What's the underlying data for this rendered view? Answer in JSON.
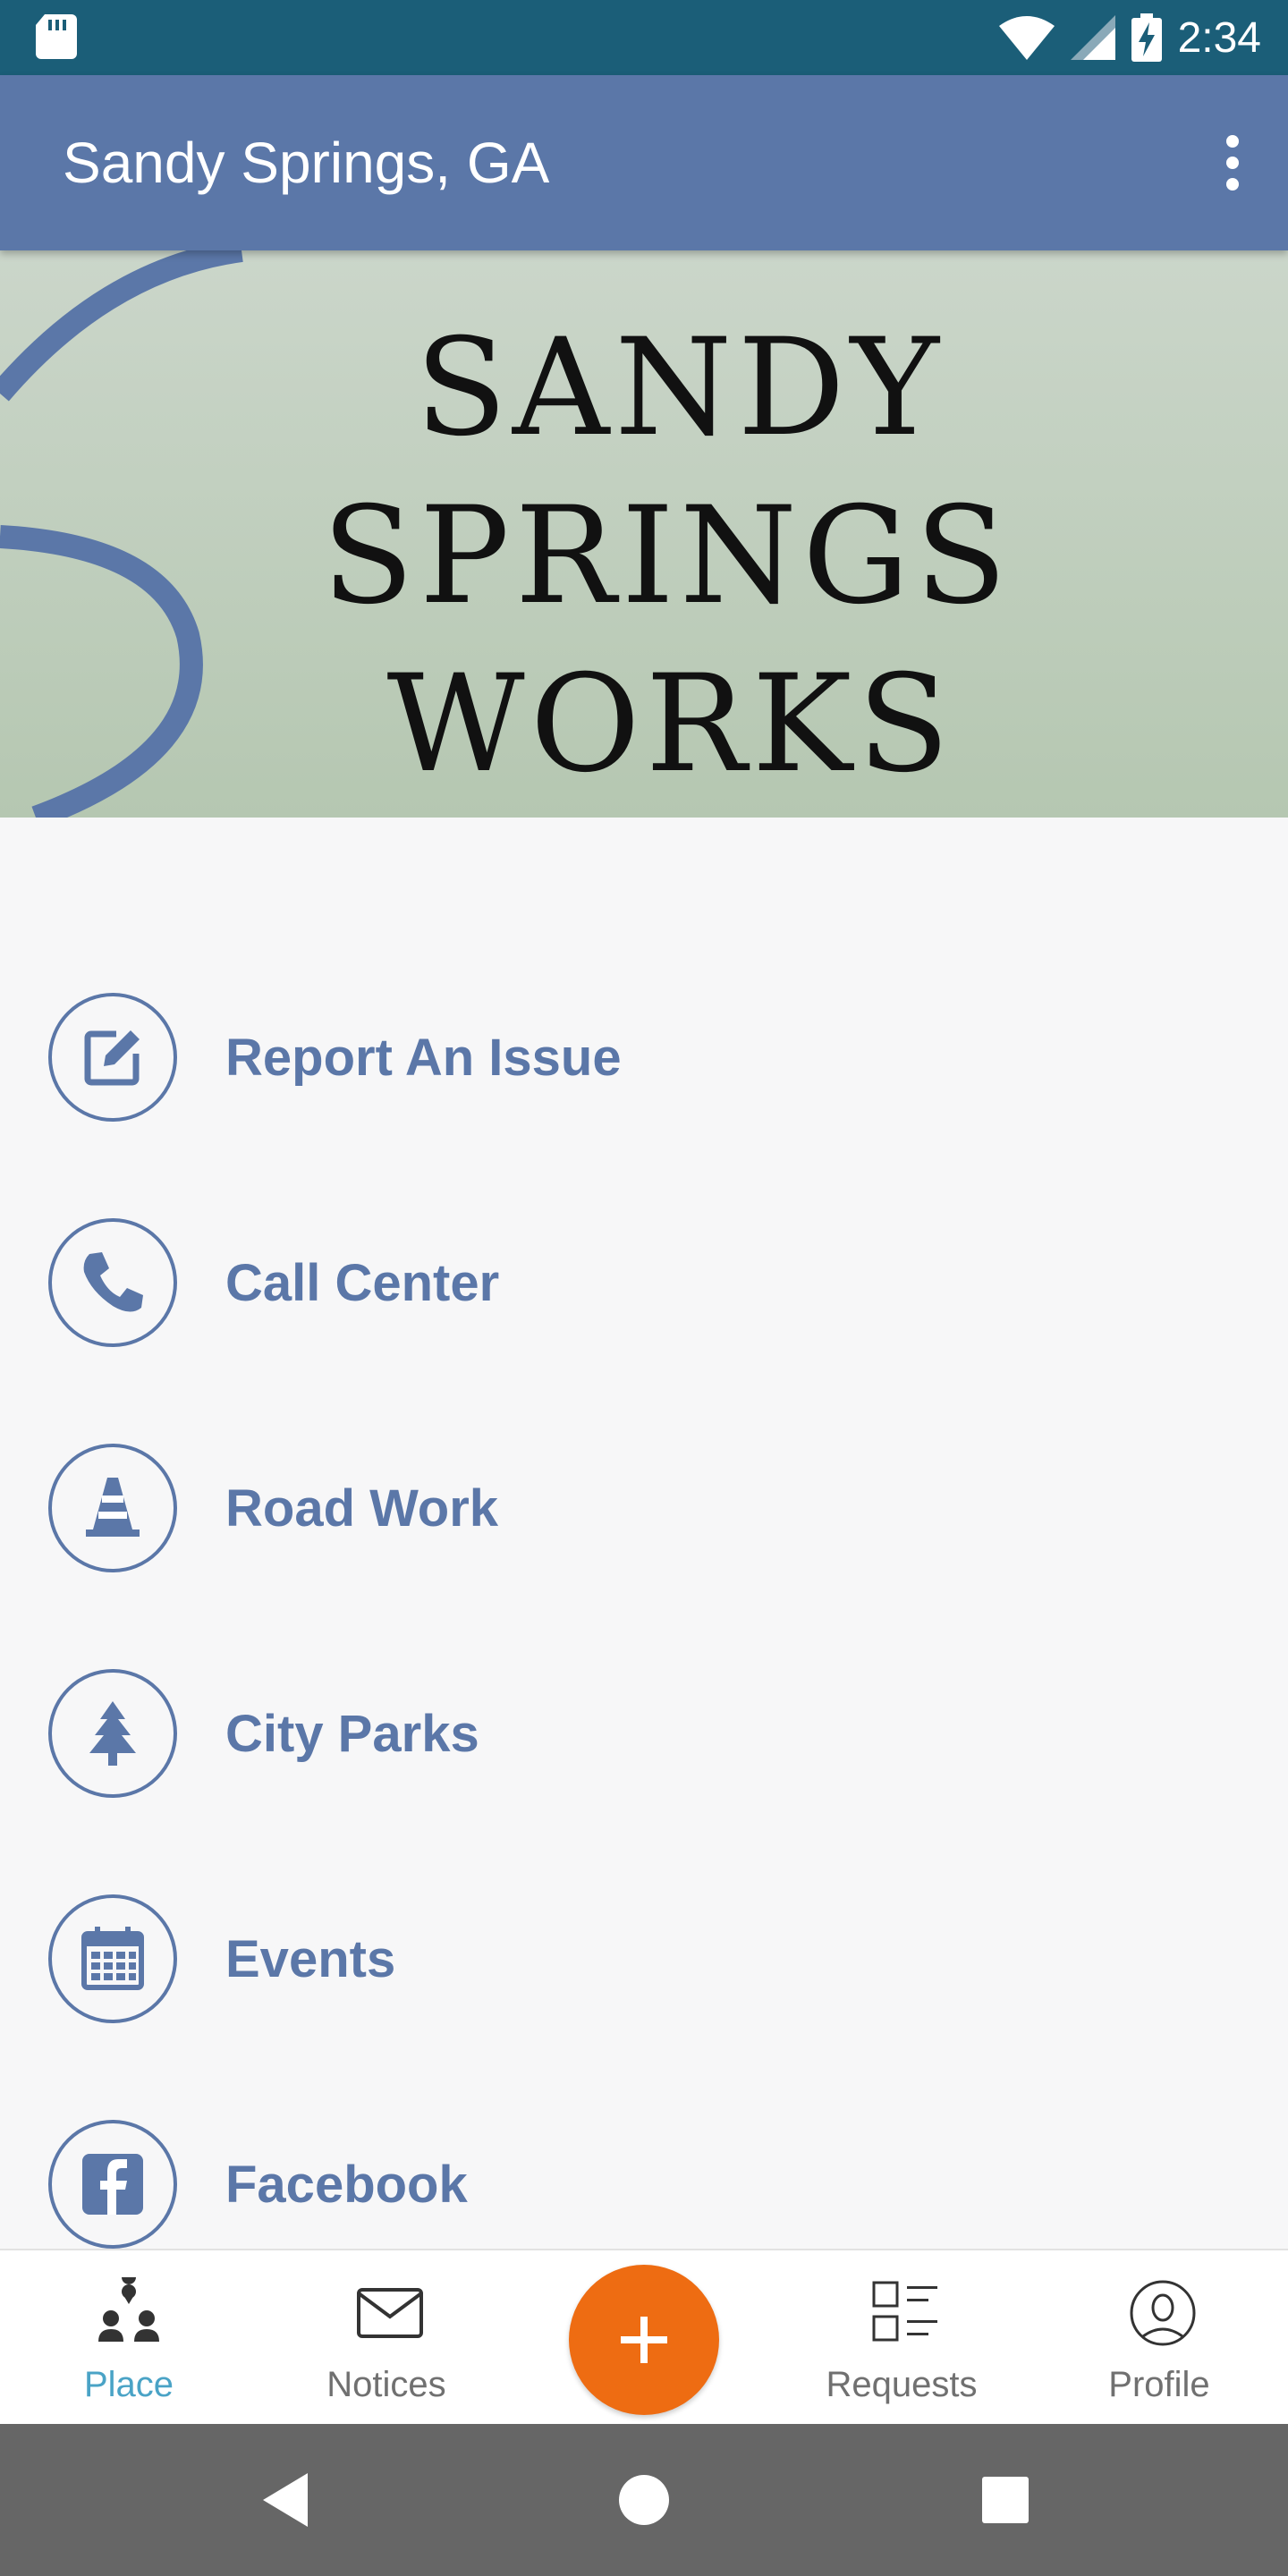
{
  "status_bar": {
    "time": "2:34"
  },
  "app_bar": {
    "title": "Sandy Springs, GA"
  },
  "banner": {
    "lines": [
      "SANDY",
      "SPRINGS",
      "WORKS"
    ]
  },
  "menu": {
    "items": [
      {
        "label": "Report An Issue",
        "icon": "edit-icon"
      },
      {
        "label": "Call Center",
        "icon": "phone-icon"
      },
      {
        "label": "Road Work",
        "icon": "traffic-cone-icon"
      },
      {
        "label": "City Parks",
        "icon": "tree-icon"
      },
      {
        "label": "Events",
        "icon": "calendar-icon"
      },
      {
        "label": "Facebook",
        "icon": "facebook-icon"
      }
    ]
  },
  "bottom_nav": {
    "items": [
      {
        "label": "Place",
        "icon": "people-pin-icon",
        "active": true
      },
      {
        "label": "Notices",
        "icon": "envelope-icon",
        "active": false
      },
      {
        "label": "Requests",
        "icon": "checklist-icon",
        "active": false
      },
      {
        "label": "Profile",
        "icon": "profile-icon",
        "active": false
      }
    ],
    "fab_icon": "plus-icon"
  },
  "colors": {
    "status_bar": "#1b5e78",
    "app_bar": "#5b77a8",
    "accent": "#ee6c12",
    "active_tab": "#4aa3c6"
  }
}
